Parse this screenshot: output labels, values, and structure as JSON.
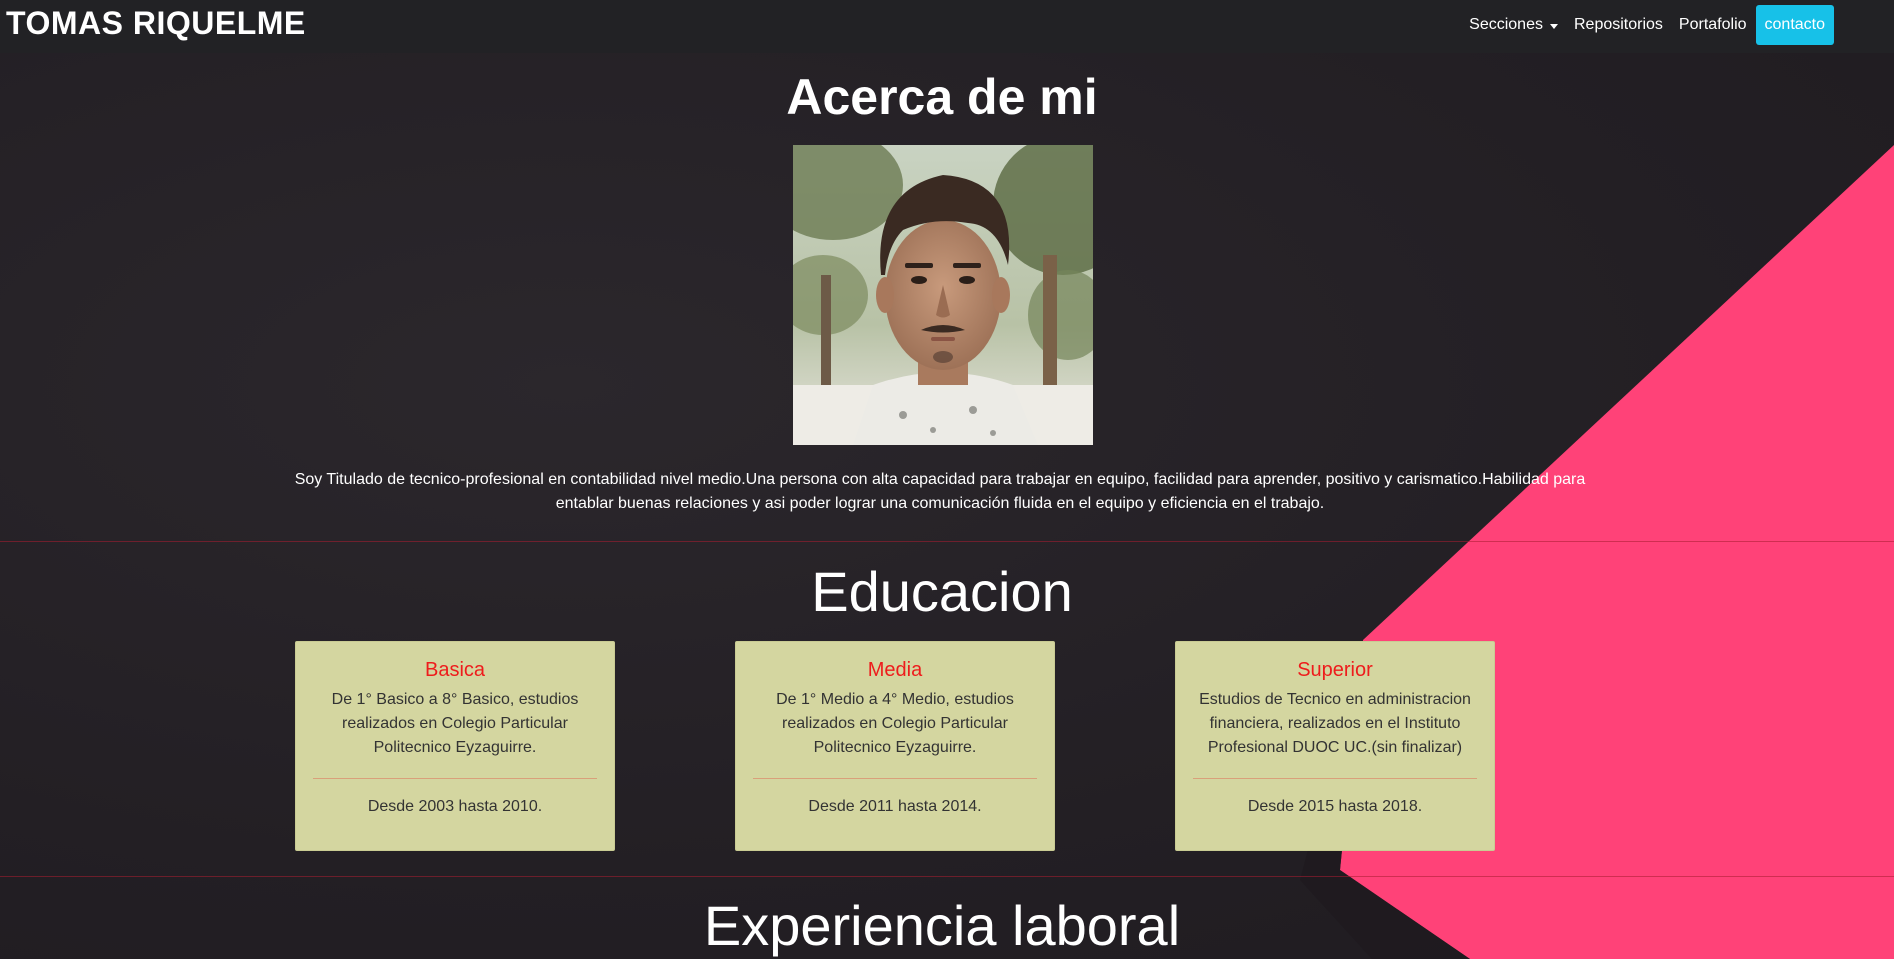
{
  "navbar": {
    "brand": "TOMAS RIQUELME",
    "items": [
      {
        "label": "Secciones"
      },
      {
        "label": "Repositorios"
      },
      {
        "label": "Portafolio"
      }
    ],
    "contact_label": "contacto"
  },
  "about": {
    "title": "Acerca de mi",
    "text": "Soy Titulado de tecnico-profesional en contabilidad nivel medio.Una persona con alta capacidad para trabajar en equipo, facilidad para aprender, positivo y carismatico.Habilidad para entablar buenas relaciones y asi poder lograr una comunicación fluida en el equipo y eficiencia en el trabajo."
  },
  "education": {
    "title": "Educacion",
    "cards": [
      {
        "title": "Basica",
        "description": "De 1° Basico a 8° Basico, estudios realizados en Colegio Particular Politecnico Eyzaguirre.",
        "dates": "Desde 2003 hasta 2010."
      },
      {
        "title": "Media",
        "description": "De 1° Medio a 4° Medio, estudios realizados en Colegio Particular Politecnico Eyzaguirre.",
        "dates": "Desde 2011 hasta 2014."
      },
      {
        "title": "Superior",
        "description": "Estudios de Tecnico en administracion financiera, realizados en el Instituto Profesional DUOC UC.(sin finalizar)",
        "dates": "Desde 2015 hasta 2018."
      }
    ]
  },
  "experience": {
    "title": "Experiencia laboral"
  },
  "colors": {
    "accent_pink": "#ff4278",
    "contact_button": "#17c1e8",
    "card_background": "#d4d6a0",
    "card_title": "#ee1c1c"
  }
}
